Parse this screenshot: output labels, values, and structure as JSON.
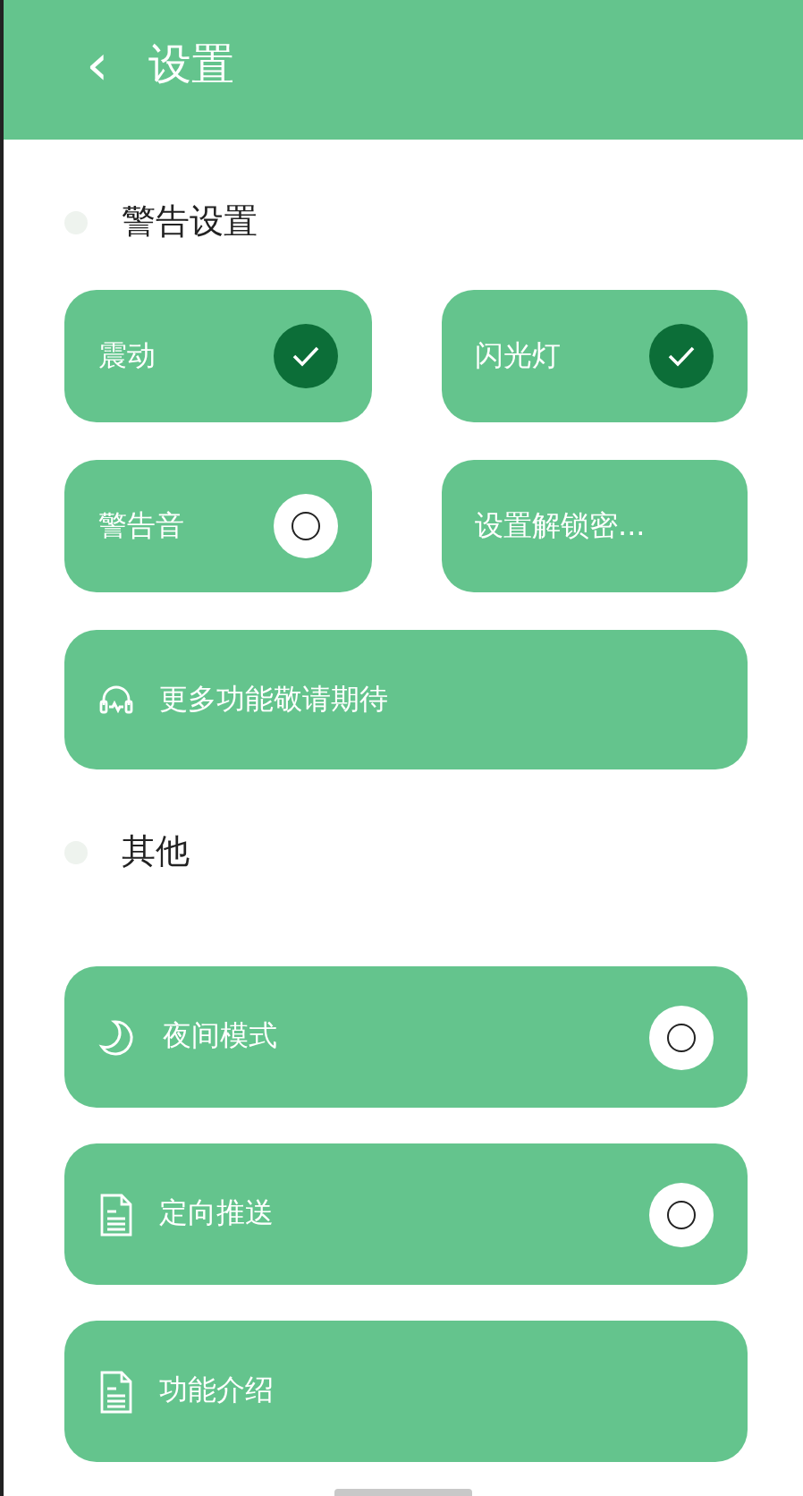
{
  "header": {
    "back_icon": "‹",
    "title": "设置"
  },
  "sections": [
    {
      "title": "警告设置",
      "items": [
        {
          "kind": "toggle",
          "label": "震动",
          "checked": true
        },
        {
          "kind": "toggle",
          "label": "闪光灯",
          "checked": true
        },
        {
          "kind": "toggle",
          "label": "警告音",
          "checked": false
        },
        {
          "kind": "plain",
          "label": "设置解锁密..."
        },
        {
          "kind": "wide",
          "label": "更多功能敬请期待"
        }
      ]
    },
    {
      "title": "其他",
      "items": [
        {
          "kind": "toggle",
          "label": "夜间模式",
          "checked": false
        },
        {
          "kind": "toggle",
          "label": "定向推送",
          "checked": false
        },
        {
          "kind": "plain",
          "label": "功能介绍"
        }
      ]
    }
  ]
}
